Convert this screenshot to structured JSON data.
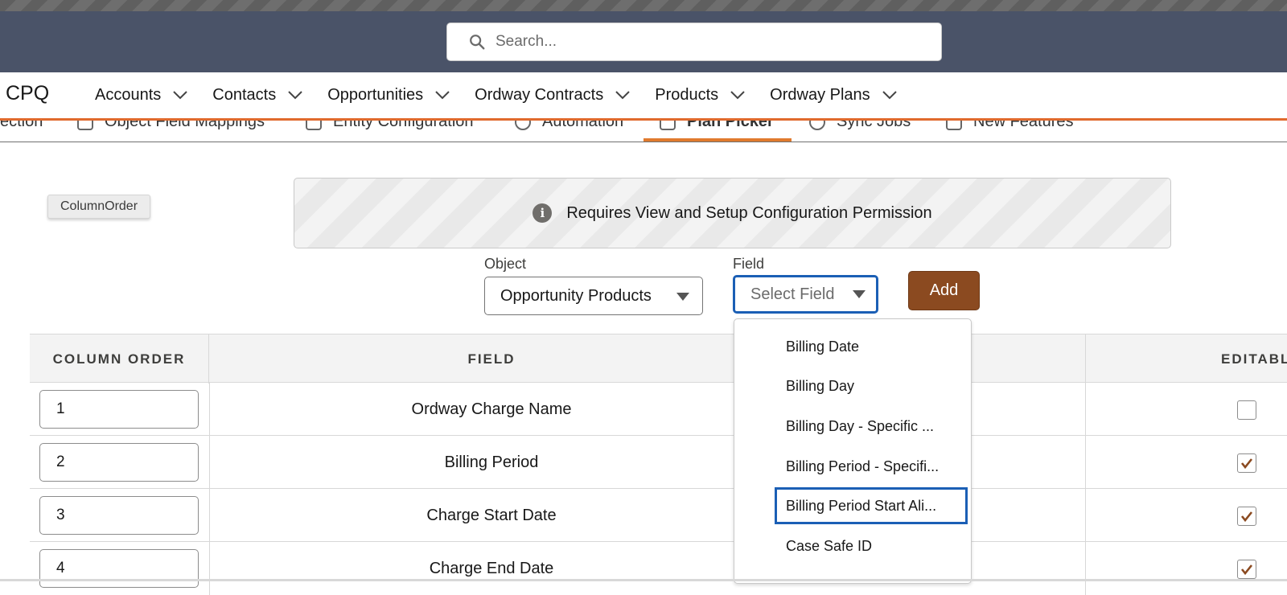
{
  "search": {
    "placeholder": "Search..."
  },
  "app": {
    "name": "CPQ"
  },
  "nav": {
    "items": [
      {
        "label": "Accounts"
      },
      {
        "label": "Contacts"
      },
      {
        "label": "Opportunities"
      },
      {
        "label": "Ordway Contracts"
      },
      {
        "label": "Products"
      },
      {
        "label": "Ordway Plans"
      }
    ]
  },
  "subtabs": {
    "items": [
      {
        "label": "ection"
      },
      {
        "label": "Object Field Mappings"
      },
      {
        "label": "Entity Configuration"
      },
      {
        "label": "Automation"
      },
      {
        "label": "Plan Picker"
      },
      {
        "label": "Sync Jobs"
      },
      {
        "label": "New Features"
      }
    ]
  },
  "pill": {
    "label": "ColumnOrder"
  },
  "notice": {
    "text": "Requires View and Setup Configuration Permission",
    "icon": "info-icon"
  },
  "form": {
    "object_label": "Object",
    "object_value": "Opportunity Products",
    "field_label": "Field",
    "field_placeholder": "Select Field",
    "add_label": "Add"
  },
  "table": {
    "headers": {
      "order": "COLUMN ORDER",
      "field": "FIELD",
      "editable": "EDITABLE"
    },
    "rows": [
      {
        "order": "1",
        "field": "Ordway Charge Name",
        "editable": false
      },
      {
        "order": "2",
        "field": "Billing Period",
        "editable": true
      },
      {
        "order": "3",
        "field": "Charge Start Date",
        "editable": true
      },
      {
        "order": "4",
        "field": "Charge End Date",
        "editable": true
      }
    ]
  },
  "dropdown": {
    "options": [
      {
        "label": "Billing Date"
      },
      {
        "label": "Billing Day"
      },
      {
        "label": "Billing Day - Specific ..."
      },
      {
        "label": "Billing Period - Specifi..."
      },
      {
        "label": "Billing Period Start Ali..."
      },
      {
        "label": "Case Safe ID"
      }
    ],
    "focused_index": 4
  },
  "colors": {
    "header": "#4a5368",
    "accent": "#e06a2d",
    "brand_button": "#8b4a20",
    "focus": "#1b5fb5",
    "check": "#8b4a20"
  }
}
